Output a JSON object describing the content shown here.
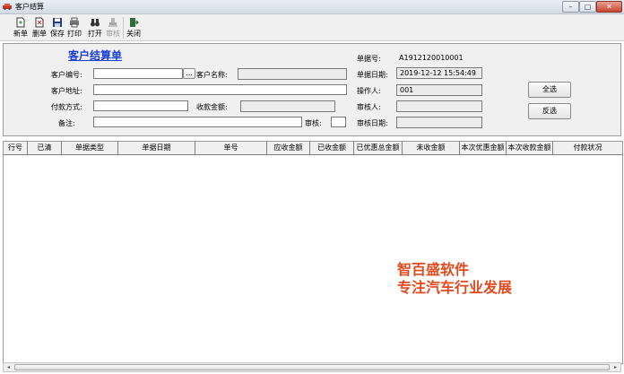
{
  "window": {
    "title": "客户结算",
    "controls": [
      "–",
      "□",
      "✕"
    ]
  },
  "toolbar": {
    "new": "新单",
    "delete": "删单",
    "save": "保存",
    "print": "打印",
    "open": "打开",
    "audit": "审核",
    "close": "关闭"
  },
  "form": {
    "doc_title": "客户结算单",
    "customer_no_label": "客户编号:",
    "customer_no_value": "",
    "lookup_button": "...",
    "customer_name_label": "客户名称:",
    "customer_name_value": "",
    "address_label": "客户地址:",
    "address_value": "",
    "payment_method_label": "付款方式:",
    "payment_method_value": "",
    "received_amount_label": "收款金额:",
    "received_amount_value": "",
    "remark_label": "备注:",
    "remark_value": "",
    "audit_label": "审核:",
    "doc_no_label": "单据号:",
    "doc_no_value": "A1912120010001",
    "doc_date_label": "单据日期:",
    "doc_date_value": "2019-12-12 15:54:49",
    "operator_label": "操作人:",
    "operator_value": "001",
    "auditor_label": "审核人:",
    "auditor_value": "",
    "audit_date_label": "审核日期:",
    "audit_date_value": "",
    "select_all_button": "全选",
    "invert_button": "反选"
  },
  "grid": {
    "columns": [
      "行号",
      "已清",
      "单据类型",
      "单据日期",
      "单号",
      "应收金额",
      "已收金额",
      "已优惠总金额",
      "未收金额",
      "本次优惠金额",
      "本次收款金额",
      "付款状况"
    ],
    "rows": []
  },
  "watermark": {
    "line1": "智百盛软件",
    "line2": "专注汽车行业发展"
  },
  "colors": {
    "doc_title": "#1a3fd6",
    "watermark": "#e24a1e"
  }
}
